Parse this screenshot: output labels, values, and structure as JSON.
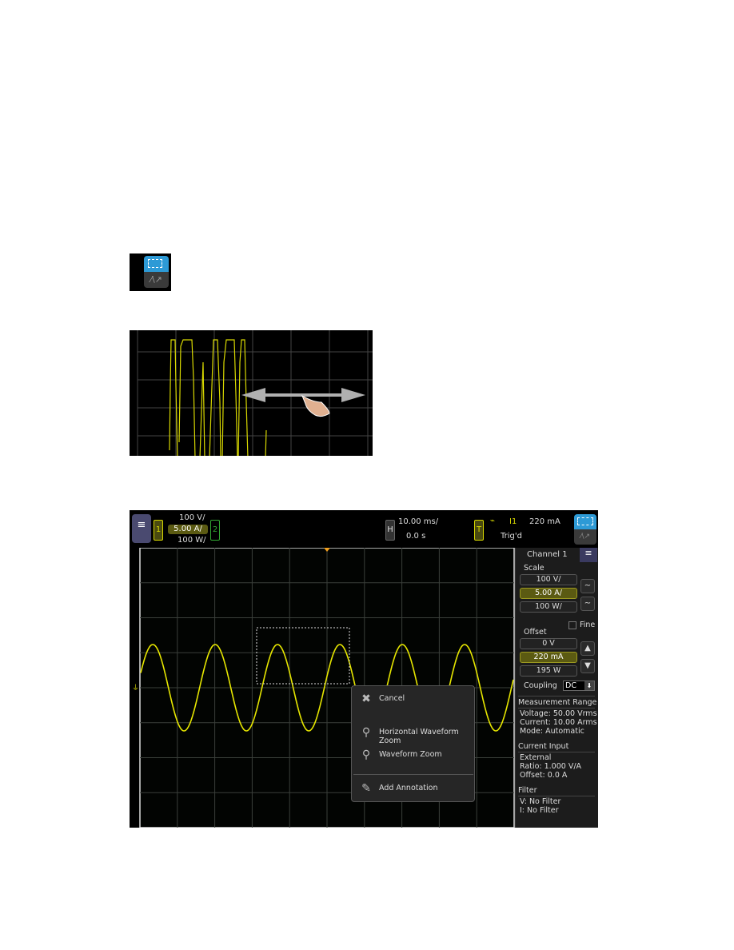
{
  "tool_icon": {
    "name": "touch-zoom-mode-icon",
    "secondary": "freehand-icon"
  },
  "example": {
    "gesture": "drag-horizontal",
    "arrow_color": "#b0b0b0",
    "trace_color": "#e6e600"
  },
  "topbar": {
    "channel1": "1",
    "channel2": "2",
    "scale_voltage": "100 V/",
    "scale_current": "5.00 A/",
    "scale_power": "100 W/",
    "horizontal_label": "H",
    "time_per_div": "10.00 ms/",
    "time_delay": "0.0 s",
    "trigger_label": "T",
    "trigger_slope": "falling-edge-icon",
    "trigger_channel": "I1",
    "trigger_level": "220 mA",
    "trigger_status": "Trig'd"
  },
  "panel": {
    "title": "Channel 1",
    "scale_label": "Scale",
    "scale_values": [
      "100 V/",
      "5.00 A/",
      "100 W/"
    ],
    "fine_label": "Fine",
    "fine_checked": false,
    "offset_label": "Offset",
    "offset_values": [
      "0 V",
      "220 mA",
      "195 W"
    ],
    "coupling_label": "Coupling",
    "coupling_value": "DC",
    "measurement_range_title": "Measurement Range",
    "voltage": "Voltage: 50.00 Vrms",
    "current": "Current: 10.00 Arms",
    "mode": "Mode: Automatic",
    "current_input_title": "Current Input",
    "external": "External",
    "ratio": "Ratio:  1.000 V/A",
    "offset": "Offset: 0.0 A",
    "filter_title": "Filter",
    "filter_v": "V: No Filter",
    "filter_i": "I: No Filter"
  },
  "menu": {
    "items": [
      {
        "label": "Cancel",
        "icon": "cancel-icon"
      },
      {
        "label": "Horizontal Waveform Zoom",
        "icon": "horizontal-zoom-icon"
      },
      {
        "label": "Waveform Zoom",
        "icon": "waveform-zoom-icon"
      },
      {
        "label": "Add Annotation",
        "icon": "annotation-icon"
      }
    ]
  },
  "colors": {
    "channel1": "#e6e600",
    "selected": "#5b5a12",
    "accent": "#2d9ad6",
    "trigger_marker": "#f0a020"
  }
}
